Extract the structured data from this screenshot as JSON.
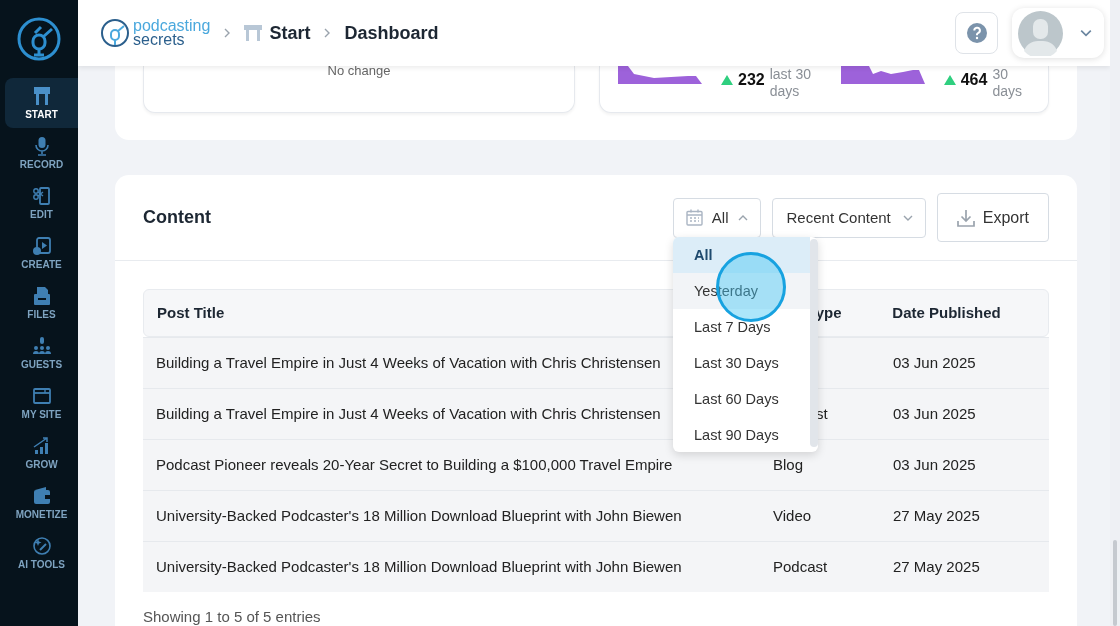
{
  "sidebar": {
    "items": [
      {
        "label": "START",
        "selected": true
      },
      {
        "label": "RECORD",
        "selected": false
      },
      {
        "label": "EDIT",
        "selected": false
      },
      {
        "label": "CREATE",
        "selected": false
      },
      {
        "label": "FILES",
        "selected": false
      },
      {
        "label": "GUESTS",
        "selected": false
      },
      {
        "label": "MY SITE",
        "selected": false
      },
      {
        "label": "GROW",
        "selected": false
      },
      {
        "label": "MONETIZE",
        "selected": false
      },
      {
        "label": "AI TOOLS",
        "selected": false
      }
    ]
  },
  "header": {
    "logo": {
      "line1": "podcasting",
      "line2": "secrets"
    },
    "breadcrumbs": [
      {
        "label": "Start",
        "kind": "start"
      },
      {
        "label": "Dashboard",
        "kind": "current"
      }
    ]
  },
  "stats": {
    "left": {
      "note": "No change"
    },
    "right": {
      "items": [
        {
          "value": "232",
          "rising": true,
          "caption": "last 30 days"
        },
        {
          "value": "464",
          "rising": true,
          "caption": "30 days"
        }
      ]
    }
  },
  "content": {
    "title": "Content",
    "date_filter": {
      "value": "All",
      "expanded": true
    },
    "sort_filter": {
      "value": "Recent Content",
      "expanded": false
    },
    "export_button": "Export",
    "date_menu": [
      {
        "label": "All",
        "selected": true,
        "hovered": false
      },
      {
        "label": "Yesterday",
        "selected": false,
        "hovered": true
      },
      {
        "label": "Last 7 Days",
        "selected": false,
        "hovered": false
      },
      {
        "label": "Last 30 Days",
        "selected": false,
        "hovered": false
      },
      {
        "label": "Last 60 Days",
        "selected": false,
        "hovered": false
      },
      {
        "label": "Last 90 Days",
        "selected": false,
        "hovered": false
      }
    ],
    "table": {
      "columns": [
        {
          "label": "Post Title"
        },
        {
          "label": "ype"
        },
        {
          "label": "Date Published"
        }
      ],
      "rows": [
        {
          "title": "Building a Travel Empire in Just 4 Weeks of Vacation with Chris Christensen",
          "date": "03 Jun 2025"
        },
        {
          "title": "Building a Travel Empire in Just 4 Weeks of Vacation with Chris Christensen",
          "type": "st",
          "date": "03 Jun 2025"
        },
        {
          "title": "Podcast Pioneer reveals 20-Year Secret to Building a $100,000 Travel Empire",
          "type": "Blog",
          "date": "03 Jun 2025"
        },
        {
          "title": "University-Backed Podcaster's 18 Million Download Blueprint with John Biewen",
          "type": "Video",
          "date": "27 May 2025"
        },
        {
          "title": "University-Backed Podcaster's 18 Million Download Blueprint with John Biewen",
          "type": "Podcast",
          "date": "27 May 2025"
        }
      ]
    },
    "footer": "Showing 1 to 5 of 5 entries"
  }
}
